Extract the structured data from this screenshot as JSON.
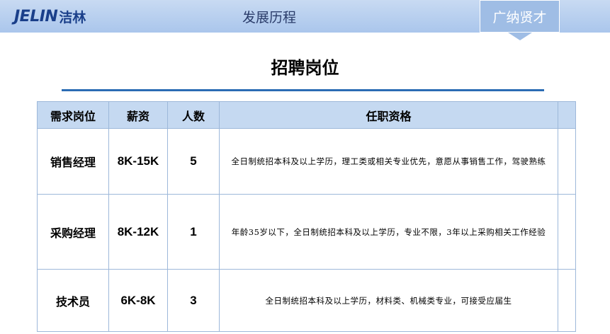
{
  "header": {
    "logo_latin": "JELIN",
    "logo_cjk": "洁林",
    "nav": [
      {
        "label": "发展历程",
        "active": false
      },
      {
        "label": "广纳贤才",
        "active": true
      }
    ]
  },
  "page": {
    "title": "招聘岗位"
  },
  "table": {
    "headers": [
      "需求岗位",
      "薪资",
      "人数",
      "任职资格"
    ],
    "rows": [
      {
        "position": "销售经理",
        "salary": "8K-15K",
        "count": "5",
        "requirements": "全日制统招本科及以上学历，理工类或相关专业优先，意愿从事销售工作，驾驶熟练"
      },
      {
        "position": "采购经理",
        "salary": "8K-12K",
        "count": "1",
        "requirements": "年龄35岁以下，全日制统招本科及以上学历，专业不限，3年以上采购相关工作经验"
      },
      {
        "position": "技术员",
        "salary": "6K-8K",
        "count": "3",
        "requirements": "全日制统招本科及以上学历，材料类、机械类专业，可接受应届生"
      }
    ]
  },
  "colors": {
    "nav_bar": "#aac6ec",
    "accent_rule": "#2b6cb4",
    "table_header": "#c5d9f1",
    "table_border": "#9db8da"
  }
}
